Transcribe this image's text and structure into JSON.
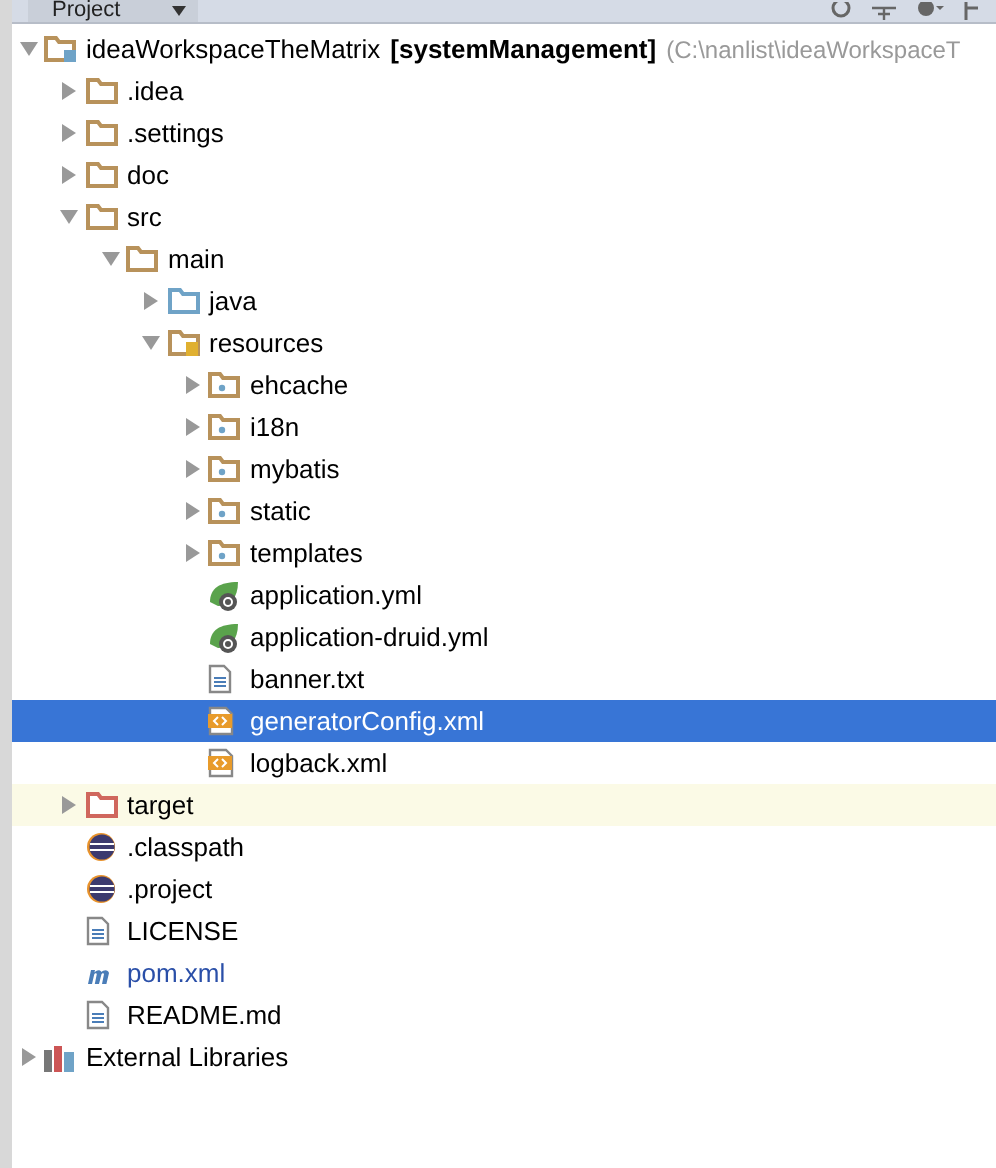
{
  "header": {
    "title": "Project"
  },
  "tree": [
    {
      "kind": "project",
      "label": "ideaWorkspaceTheMatrix",
      "module": "[systemManagement]",
      "path": "(C:\\nanlist\\ideaWorkspaceT",
      "expanded": true,
      "selected": false,
      "children": [
        {
          "kind": "folder",
          "label": ".idea",
          "expanded": false,
          "selected": false
        },
        {
          "kind": "folder",
          "label": ".settings",
          "expanded": false,
          "selected": false
        },
        {
          "kind": "folder",
          "label": "doc",
          "expanded": false,
          "selected": false
        },
        {
          "kind": "folder",
          "label": "src",
          "expanded": true,
          "selected": false,
          "children": [
            {
              "kind": "folder",
              "label": "main",
              "expanded": true,
              "selected": false,
              "children": [
                {
                  "kind": "source-root",
                  "label": "java",
                  "expanded": false,
                  "selected": false
                },
                {
                  "kind": "resource-root",
                  "label": "resources",
                  "expanded": true,
                  "selected": false,
                  "children": [
                    {
                      "kind": "package",
                      "label": "ehcache",
                      "expanded": false,
                      "selected": false
                    },
                    {
                      "kind": "package",
                      "label": "i18n",
                      "expanded": false,
                      "selected": false
                    },
                    {
                      "kind": "package",
                      "label": "mybatis",
                      "expanded": false,
                      "selected": false
                    },
                    {
                      "kind": "package",
                      "label": "static",
                      "expanded": false,
                      "selected": false
                    },
                    {
                      "kind": "package",
                      "label": "templates",
                      "expanded": false,
                      "selected": false
                    },
                    {
                      "kind": "spring",
                      "label": "application.yml",
                      "selected": false
                    },
                    {
                      "kind": "spring",
                      "label": "application-druid.yml",
                      "selected": false
                    },
                    {
                      "kind": "text",
                      "label": "banner.txt",
                      "selected": false
                    },
                    {
                      "kind": "xml",
                      "label": "generatorConfig.xml",
                      "selected": true
                    },
                    {
                      "kind": "xml",
                      "label": "logback.xml",
                      "selected": false
                    }
                  ]
                }
              ]
            }
          ]
        },
        {
          "kind": "excluded",
          "label": "target",
          "expanded": false,
          "selected": false,
          "highlighted": true
        },
        {
          "kind": "eclipse",
          "label": ".classpath",
          "selected": false
        },
        {
          "kind": "eclipse",
          "label": ".project",
          "selected": false
        },
        {
          "kind": "text",
          "label": "LICENSE",
          "selected": false
        },
        {
          "kind": "maven",
          "label": "pom.xml",
          "selected": false
        },
        {
          "kind": "text",
          "label": "README.md",
          "selected": false
        }
      ]
    },
    {
      "kind": "libraries",
      "label": "External Libraries",
      "expanded": false,
      "selected": false
    }
  ]
}
